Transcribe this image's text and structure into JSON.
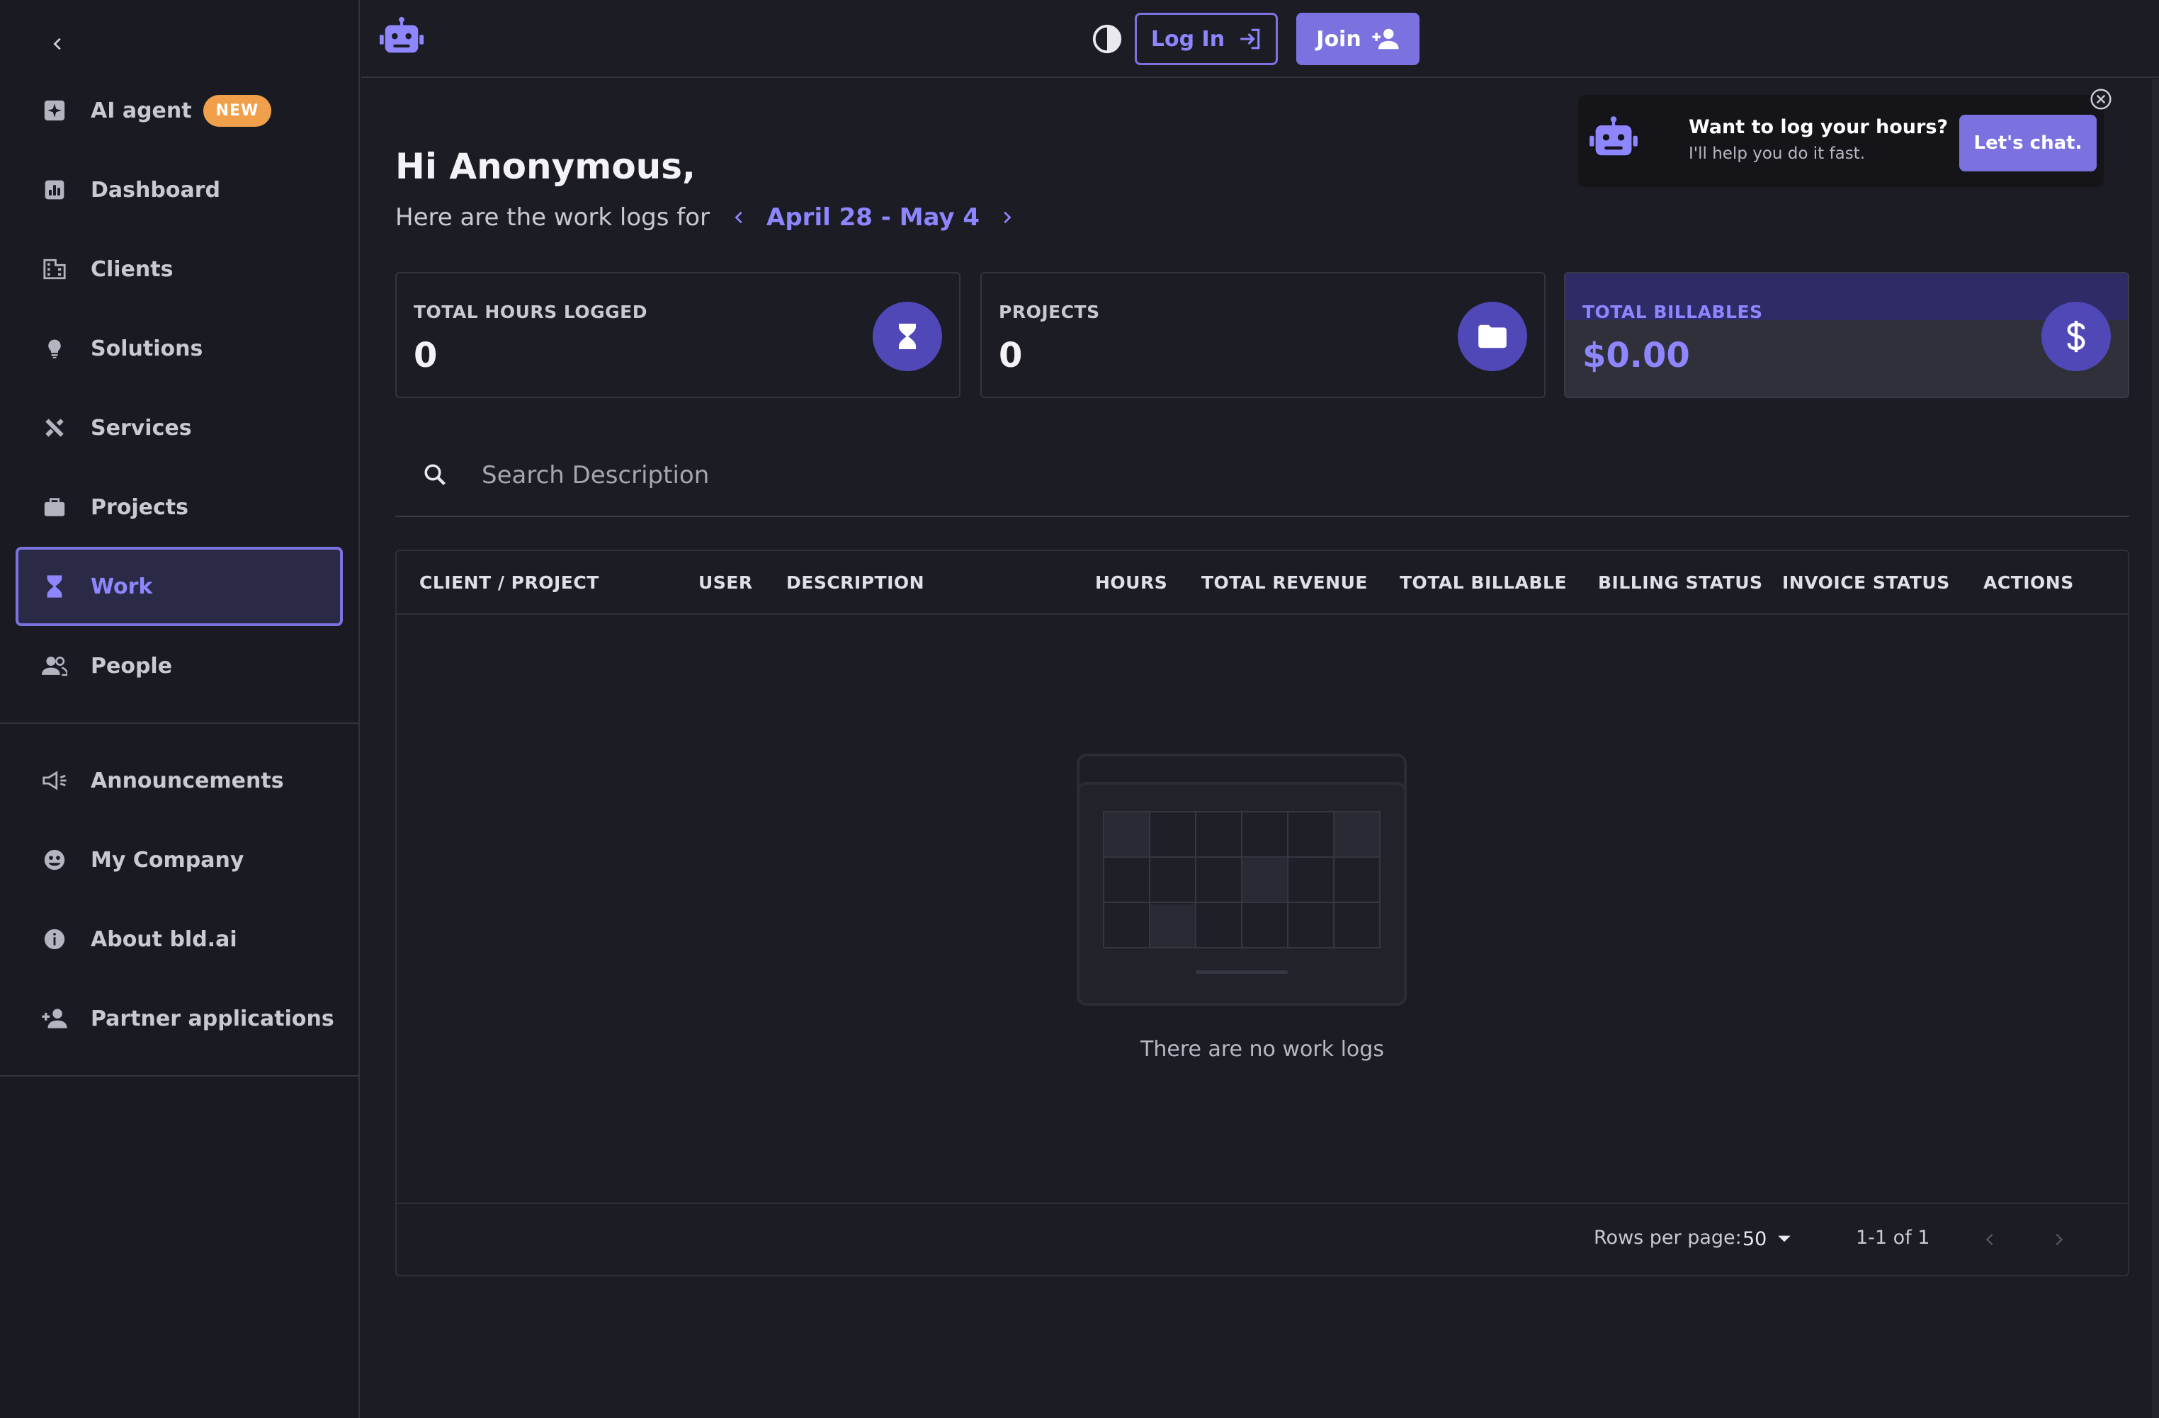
{
  "sidebar": {
    "items": [
      {
        "label": "AI agent",
        "icon": "ai-sparkle-icon",
        "badge": "NEW"
      },
      {
        "label": "Dashboard",
        "icon": "chart-icon"
      },
      {
        "label": "Clients",
        "icon": "building-icon"
      },
      {
        "label": "Solutions",
        "icon": "lightbulb-icon"
      },
      {
        "label": "Services",
        "icon": "tools-icon"
      },
      {
        "label": "Projects",
        "icon": "briefcase-icon"
      },
      {
        "label": "Work",
        "icon": "hourglass-icon",
        "active": true
      },
      {
        "label": "People",
        "icon": "people-icon"
      }
    ],
    "secondary_items": [
      {
        "label": "Announcements",
        "icon": "megaphone-icon"
      },
      {
        "label": "My Company",
        "icon": "company-icon"
      },
      {
        "label": "About bld.ai",
        "icon": "info-icon"
      },
      {
        "label": "Partner applications",
        "icon": "person-add-icon"
      }
    ]
  },
  "header": {
    "login_label": "Log In",
    "join_label": "Join"
  },
  "main": {
    "greeting": "Hi Anonymous,",
    "subtitle": "Here are the work logs for",
    "week_range": "April 28 - May 4"
  },
  "chat_prompt": {
    "title": "Want to log your hours?",
    "subtitle": "I'll help you do it fast.",
    "button": "Let's chat."
  },
  "stats": [
    {
      "label": "TOTAL HOURS LOGGED",
      "value": "0",
      "icon": "hourglass-icon"
    },
    {
      "label": "PROJECTS",
      "value": "0",
      "icon": "folder-icon"
    },
    {
      "label": "TOTAL BILLABLES",
      "value": "$0.00",
      "icon": "dollar-icon"
    }
  ],
  "search": {
    "placeholder": "Search Description"
  },
  "table": {
    "columns": [
      "CLIENT / PROJECT",
      "USER",
      "DESCRIPTION",
      "HOURS",
      "TOTAL REVENUE",
      "TOTAL BILLABLE",
      "BILLING STATUS",
      "INVOICE STATUS",
      "ACTIONS"
    ],
    "empty_message": "There are no work logs",
    "rows_per_page_label": "Rows per page:",
    "rows_per_page": "50",
    "page_info": "1-1 of 1"
  },
  "colors": {
    "accent": "#7b72e0",
    "accent_text": "#8e86ff",
    "background": "#1c1c25",
    "badge": "#f0a04b"
  }
}
